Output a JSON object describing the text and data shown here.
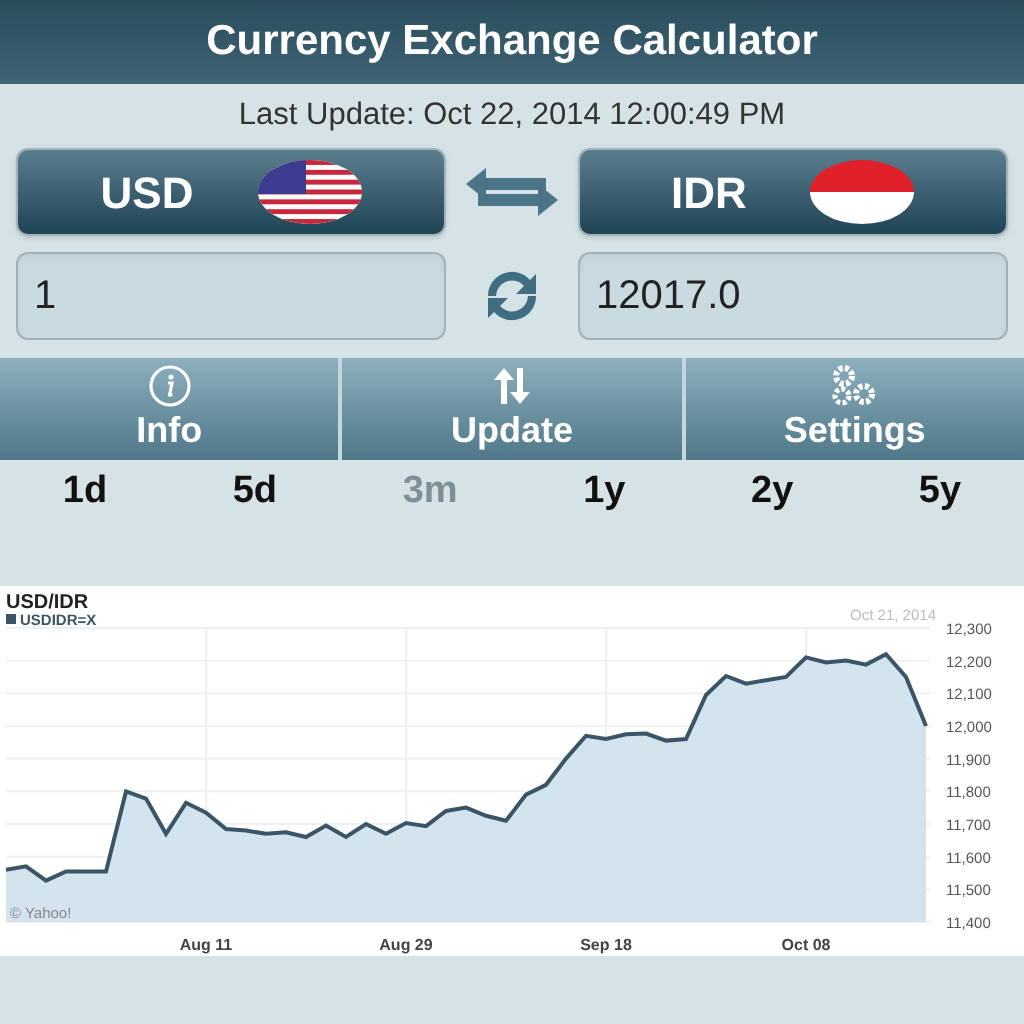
{
  "app_bar": {
    "title": "Currency Exchange Calculator"
  },
  "last_update": "Last Update: Oct 22, 2014 12:00:49 PM",
  "from_currency": {
    "code": "USD"
  },
  "to_currency": {
    "code": "IDR"
  },
  "from_amount": {
    "value": "1"
  },
  "to_amount": {
    "value": "12017.0"
  },
  "toolbar": [
    {
      "label": "Info",
      "kind": "info"
    },
    {
      "label": "Update",
      "kind": "update"
    },
    {
      "label": "Settings",
      "kind": "settings"
    }
  ],
  "periods": [
    {
      "label": "1d",
      "selected": false
    },
    {
      "label": "5d",
      "selected": false
    },
    {
      "label": "3m",
      "selected": true
    },
    {
      "label": "1y",
      "selected": false
    },
    {
      "label": "2y",
      "selected": false
    },
    {
      "label": "5y",
      "selected": false
    }
  ],
  "chart": {
    "date": "Oct 21, 2014",
    "credit": "© Yahoo!",
    "chart_data": {
      "type": "area",
      "title": "USD/IDR",
      "categories": [
        null,
        null,
        null,
        null,
        null,
        null,
        null,
        null,
        null,
        null,
        "Aug 11",
        null,
        null,
        null,
        null,
        null,
        null,
        null,
        null,
        null,
        "Aug 29",
        null,
        null,
        null,
        null,
        null,
        null,
        null,
        null,
        null,
        "Sep 18",
        null,
        null,
        null,
        null,
        null,
        null,
        null,
        null,
        null,
        "Oct 08",
        null,
        null,
        null,
        null,
        null,
        null
      ],
      "series": [
        {
          "name": "USDIDR=X",
          "color": "#3b5566",
          "values": [
            11560,
            11570,
            11527,
            11555,
            11555,
            11555,
            11800,
            11778,
            11670,
            11765,
            11735,
            11685,
            11680,
            11670,
            11675,
            11660,
            11695,
            11660,
            11700,
            11670,
            11703,
            11693,
            11740,
            11750,
            11725,
            11710,
            11790,
            11820,
            11900,
            11970,
            11960,
            11975,
            11977,
            11955,
            11960,
            12095,
            12153,
            12130,
            12140,
            12150,
            12210,
            12195,
            12200,
            12188,
            12220,
            12150,
            12000
          ]
        }
      ],
      "grid": true,
      "ylim": [
        11400,
        12300
      ],
      "yticks": [
        {
          "value": 12300,
          "label": "12,300"
        },
        {
          "value": 12200,
          "label": "12,200"
        },
        {
          "value": 12100,
          "label": "12,100"
        },
        {
          "value": 12000,
          "label": "12,000"
        },
        {
          "value": 11900,
          "label": "11,900"
        },
        {
          "value": 11800,
          "label": "11,800"
        },
        {
          "value": 11700,
          "label": "11,700"
        },
        {
          "value": 11600,
          "label": "11,600"
        },
        {
          "value": 11500,
          "label": "11,500"
        },
        {
          "value": 11400,
          "label": "11,400"
        }
      ]
    }
  }
}
